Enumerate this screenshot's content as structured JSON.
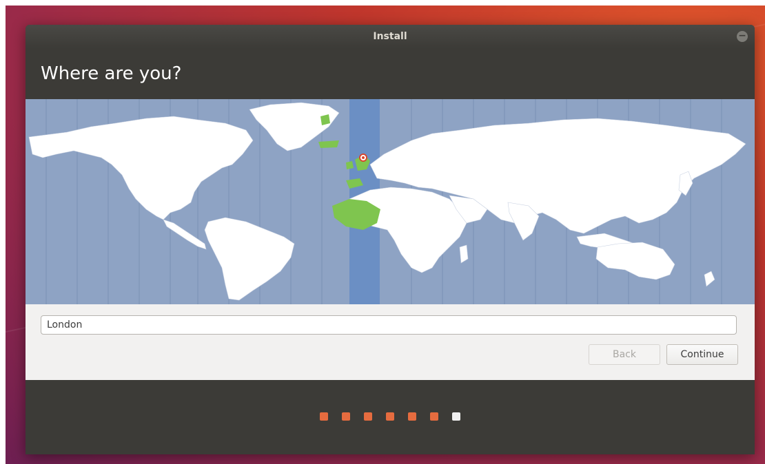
{
  "window": {
    "title": "Install"
  },
  "page": {
    "heading": "Where are you?"
  },
  "location": {
    "value": "London"
  },
  "buttons": {
    "back": "Back",
    "continue": "Continue"
  },
  "progress": {
    "total_steps": 7,
    "current_step": 7
  },
  "colors": {
    "titlebar": "#3c3b37",
    "ocean": "#8ea3c4",
    "land": "#ffffff",
    "selected_timezone_band": "#6b8fc4",
    "selected_region": "#7fc54f",
    "progress_dot": "#e66c3f",
    "progress_dot_current": "#f0f0f0"
  }
}
